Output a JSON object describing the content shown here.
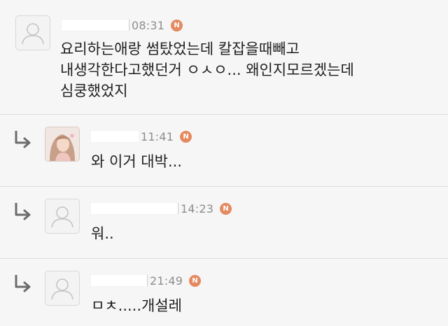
{
  "comments": [
    {
      "time": "08:31",
      "badge": "N",
      "lines": [
        "요리하는애랑 썸탔었는데 칼잡을때빼고",
        "내생각한다고했던거 ㅇㅅㅇ... 왜인지모르겠는데",
        "심쿵했었지"
      ],
      "avatar": "default-avatar-icon",
      "is_reply": false
    },
    {
      "time": "11:41",
      "badge": "N",
      "lines": [
        "와 이거 대박..."
      ],
      "avatar": "profile-photo",
      "is_reply": true
    },
    {
      "time": "14:23",
      "badge": "N",
      "lines": [
        "워.."
      ],
      "avatar": "default-avatar-icon",
      "is_reply": true
    },
    {
      "time": "21:49",
      "badge": "N",
      "lines": [
        "ㅁㅊ.....개설레"
      ],
      "avatar": "default-avatar-icon",
      "is_reply": true
    }
  ],
  "icons": {
    "reply": "reply-arrow-icon",
    "new": "new-badge-icon"
  },
  "colors": {
    "background": "#f6f6f6",
    "badge": "#e48a60",
    "meta_text": "#8e8e8e",
    "body_text": "#202020"
  }
}
